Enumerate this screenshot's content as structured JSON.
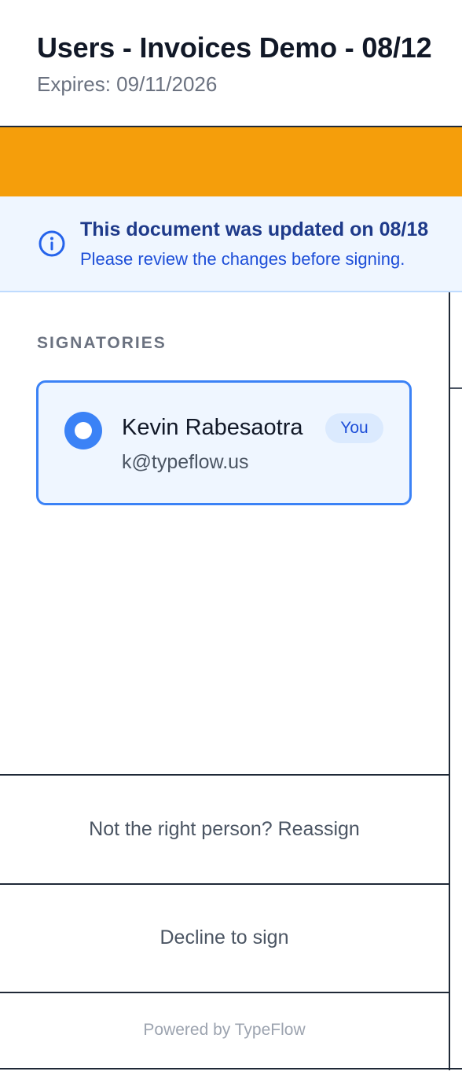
{
  "header": {
    "title": "Users - Invoices Demo - 08/12",
    "expires": "Expires: 09/11/2026"
  },
  "colors": {
    "banner_accent": "#f59e0b",
    "primary": "#3b82f6",
    "info_bg": "#eff6ff"
  },
  "update_notice": {
    "icon": "info-icon",
    "title": "This document was updated on 08/18",
    "subtitle": "Please review the changes before signing."
  },
  "signatories": {
    "label": "SIGNATORIES",
    "items": [
      {
        "name": "Kevin Rabesaotra",
        "badge": "You",
        "email": "k@typeflow.us",
        "selected": true
      }
    ]
  },
  "actions": {
    "reassign": "Not the right person? Reassign",
    "decline": "Decline to sign"
  },
  "footer": {
    "powered_by": "Powered by TypeFlow"
  }
}
